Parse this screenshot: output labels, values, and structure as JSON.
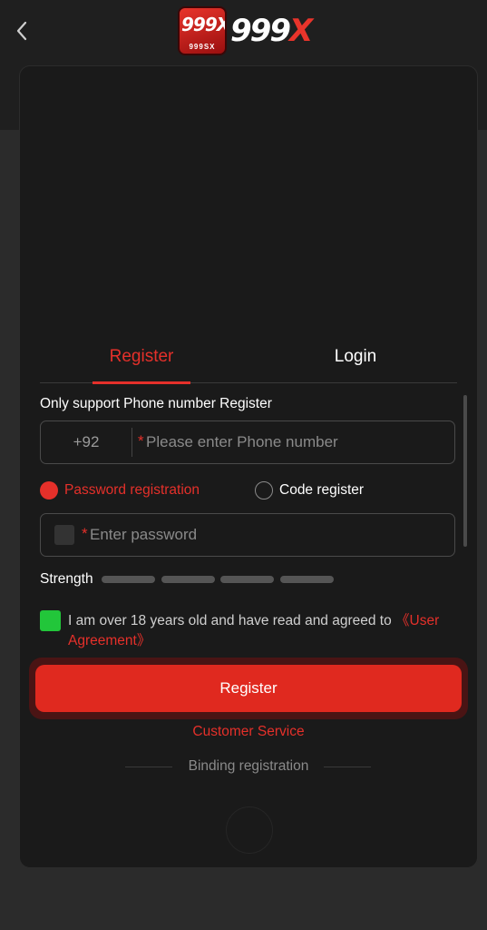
{
  "header": {
    "logo_badge_text": "999X",
    "logo_badge_sub": "999SX",
    "logo_word_main": "999",
    "logo_word_x": "X"
  },
  "tabs": [
    {
      "label": "Register",
      "active": true
    },
    {
      "label": "Login",
      "active": false
    }
  ],
  "form": {
    "support_note": "Only support Phone number Register",
    "country_code": "+92",
    "phone_placeholder": "Please enter Phone number",
    "required_mark": "*",
    "mode_options": [
      {
        "label": "Password registration",
        "selected": true
      },
      {
        "label": "Code register",
        "selected": false
      }
    ],
    "password_placeholder": "Enter password",
    "strength_label": "Strength",
    "strength_level": 0,
    "agreement_text": "I am over 18 years old and have read and agreed to ",
    "agreement_link": "《User Agreement》",
    "agreement_checked": true,
    "register_button": "Register"
  },
  "footer": {
    "customer_service": "Customer Service",
    "binding_registration": "Binding registration"
  },
  "colors": {
    "accent": "#e5302a",
    "check": "#22c63a",
    "background": "#2b2b2b",
    "card": "#1a1a1a"
  },
  "icons": [
    "back-arrow-icon",
    "eye-toggle-icon",
    "checkbox-checked-icon"
  ]
}
